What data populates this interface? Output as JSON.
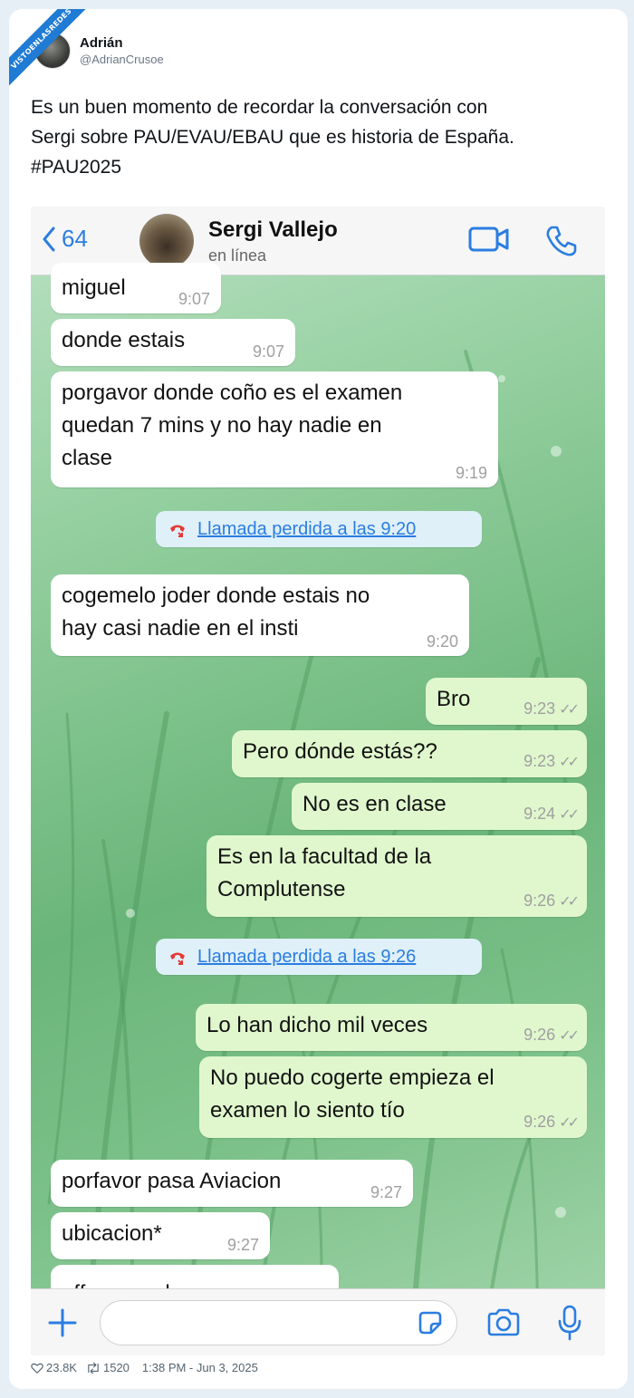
{
  "watermark": "VISTOENLASREDES",
  "author": {
    "name": "Adrián",
    "handle": "@AdrianCrusoe"
  },
  "tweet": {
    "line1": "Es un buen momento de recordar la conversación con",
    "line2": "Sergi sobre PAU/EVAU/EBAU que es historia de España.",
    "line3": "#PAU2025"
  },
  "chat": {
    "back_count": "64",
    "contact_name": "Sergi Vallejo",
    "contact_status": "en línea",
    "messages": [
      {
        "dir": "in",
        "lines": [
          "miguel"
        ],
        "time": "9:07"
      },
      {
        "dir": "in",
        "lines": [
          "donde estais"
        ],
        "time": "9:07"
      },
      {
        "dir": "in",
        "lines": [
          "porgavor donde coño es el examen",
          "quedan 7 mins y no hay nadie en",
          "clase"
        ],
        "time": "9:19"
      },
      {
        "dir": "missed",
        "text": "Llamada perdida a las 9:20"
      },
      {
        "dir": "in",
        "lines": [
          "cogemelo joder donde estais no",
          "hay casi nadie en el insti"
        ],
        "time": "9:20"
      },
      {
        "dir": "out",
        "lines": [
          "Bro"
        ],
        "time": "9:23"
      },
      {
        "dir": "out",
        "lines": [
          "Pero dónde estás??"
        ],
        "time": "9:23"
      },
      {
        "dir": "out",
        "lines": [
          "No es en clase"
        ],
        "time": "9:24"
      },
      {
        "dir": "out",
        "lines": [
          "Es en la facultad de la",
          "Complutense"
        ],
        "time": "9:26"
      },
      {
        "dir": "missed",
        "text": "Llamada perdida a las 9:26"
      },
      {
        "dir": "out",
        "lines": [
          "Lo han dicho mil veces"
        ],
        "time": "9:26"
      },
      {
        "dir": "out",
        "lines": [
          "No puedo cogerte empieza el",
          "examen lo siento tío"
        ],
        "time": "9:26"
      },
      {
        "dir": "in",
        "lines": [
          "porfavor pasa Aviacion"
        ],
        "time": "9:27"
      },
      {
        "dir": "in",
        "lines": [
          "ubicacion*"
        ],
        "time": "9:27"
      },
      {
        "dir": "in",
        "lines": [
          "pff no puede ser"
        ],
        "time": ""
      }
    ]
  },
  "stats": {
    "likes": "23.8K",
    "retweets": "1520",
    "timestamp": "1:38 PM - Jun 3, 2025"
  },
  "colors": {
    "accent": "#2b7de1",
    "outgoing_bubble": "#e0f7cd",
    "missed_call": "#e53935"
  },
  "icons": [
    "back-chevron-icon",
    "video-call-icon",
    "phone-icon",
    "missed-call-icon",
    "plus-icon",
    "sticker-icon",
    "camera-icon",
    "microphone-icon",
    "heart-icon",
    "retweet-icon"
  ]
}
